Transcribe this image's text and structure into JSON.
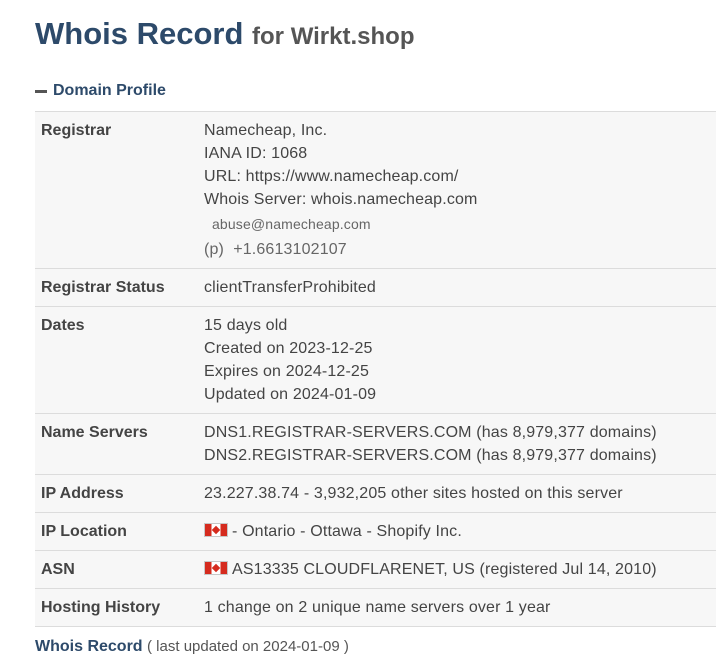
{
  "header": {
    "title": "Whois Record",
    "subtitle": "for Wirkt.shop"
  },
  "section": {
    "label": "Domain Profile",
    "toggle_icon": "minus-icon"
  },
  "profile": {
    "registrar": {
      "label": "Registrar",
      "name": "Namecheap, Inc.",
      "iana": "IANA ID: 1068",
      "url": "URL: https://www.namecheap.com/",
      "whois_server": "Whois Server: whois.namecheap.com",
      "email": "abuse@namecheap.com",
      "phone_prefix": "(p)",
      "phone": "+1.6613102107"
    },
    "status": {
      "label": "Registrar Status",
      "value": "clientTransferProhibited"
    },
    "dates": {
      "label": "Dates",
      "age": "15 days old",
      "created": "Created on 2023-12-25",
      "expires": "Expires on 2024-12-25",
      "updated": "Updated on 2024-01-09"
    },
    "name_servers": {
      "label": "Name Servers",
      "ns1": "DNS1.REGISTRAR-SERVERS.COM (has 8,979,377 domains)",
      "ns2": "DNS2.REGISTRAR-SERVERS.COM (has 8,979,377 domains)"
    },
    "ip_address": {
      "label": "IP Address",
      "value": "23.227.38.74 - 3,932,205 other sites hosted on this server"
    },
    "ip_location": {
      "label": "IP Location",
      "flag_icon": "canada-flag-icon",
      "value": "- Ontario - Ottawa - Shopify Inc."
    },
    "asn": {
      "label": "ASN",
      "flag_icon": "canada-flag-icon",
      "value": "AS13335 CLOUDFLARENET, US (registered Jul 14, 2010)"
    },
    "hosting_history": {
      "label": "Hosting History",
      "value": "1 change on 2 unique name servers over 1 year"
    }
  },
  "footer": {
    "link": "Whois Record",
    "note": "( last updated on 2024-01-09 )"
  },
  "colors": {
    "heading": "#2d4a6a",
    "row_background": "#f7f7f7",
    "border": "#dcdcdc"
  }
}
